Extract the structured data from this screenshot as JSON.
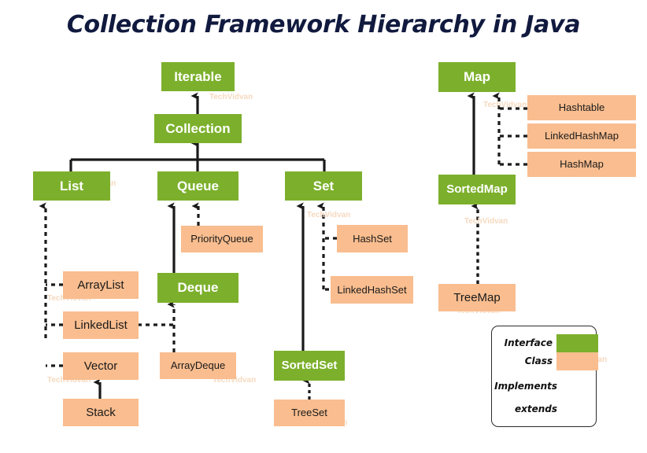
{
  "title": "Collection Framework Hierarchy in Java",
  "colors": {
    "interface": "#7cb02c",
    "class": "#f9bd8f",
    "title": "#111a3e",
    "line": "#1a1a1a",
    "background": "#ffffff",
    "watermark": "#f6d9bf"
  },
  "nodes": {
    "iterable": {
      "label": "Iterable",
      "kind": "interface"
    },
    "collection": {
      "label": "Collection",
      "kind": "interface"
    },
    "list": {
      "label": "List",
      "kind": "interface"
    },
    "queue": {
      "label": "Queue",
      "kind": "interface"
    },
    "set": {
      "label": "Set",
      "kind": "interface"
    },
    "deque": {
      "label": "Deque",
      "kind": "interface"
    },
    "sortedset": {
      "label": "SortedSet",
      "kind": "interface"
    },
    "map": {
      "label": "Map",
      "kind": "interface"
    },
    "sortedmap": {
      "label": "SortedMap",
      "kind": "interface"
    },
    "arraylist": {
      "label": "ArrayList",
      "kind": "class"
    },
    "linkedlist": {
      "label": "LinkedList",
      "kind": "class"
    },
    "vector": {
      "label": "Vector",
      "kind": "class"
    },
    "stack": {
      "label": "Stack",
      "kind": "class"
    },
    "priorityqueue": {
      "label": "PriorityQueue",
      "kind": "class"
    },
    "arraydeque": {
      "label": "ArrayDeque",
      "kind": "class"
    },
    "hashset": {
      "label": "HashSet",
      "kind": "class"
    },
    "linkedhashset": {
      "label": "LinkedHashSet",
      "kind": "class"
    },
    "treeset": {
      "label": "TreeSet",
      "kind": "class"
    },
    "hashtable": {
      "label": "Hashtable",
      "kind": "class"
    },
    "linkedhashmap": {
      "label": "LinkedHashMap",
      "kind": "class"
    },
    "hashmap": {
      "label": "HashMap",
      "kind": "class"
    },
    "treemap": {
      "label": "TreeMap",
      "kind": "class"
    }
  },
  "legend": {
    "interface_label": "Interface",
    "class_label": "Class",
    "implements_label": "Implements",
    "extends_label": "extends"
  },
  "watermark": {
    "text": "TechVidvan"
  },
  "relations": [
    {
      "from": "collection",
      "to": "iterable",
      "type": "extends"
    },
    {
      "from": "list",
      "to": "collection",
      "type": "extends"
    },
    {
      "from": "queue",
      "to": "collection",
      "type": "extends"
    },
    {
      "from": "set",
      "to": "collection",
      "type": "extends"
    },
    {
      "from": "arraylist",
      "to": "list",
      "type": "implements"
    },
    {
      "from": "linkedlist",
      "to": "list",
      "type": "implements"
    },
    {
      "from": "vector",
      "to": "list",
      "type": "implements"
    },
    {
      "from": "stack",
      "to": "vector",
      "type": "extends"
    },
    {
      "from": "priorityqueue",
      "to": "queue",
      "type": "implements"
    },
    {
      "from": "deque",
      "to": "queue",
      "type": "extends"
    },
    {
      "from": "arraydeque",
      "to": "deque",
      "type": "implements"
    },
    {
      "from": "linkedlist",
      "to": "deque",
      "type": "implements"
    },
    {
      "from": "hashset",
      "to": "set",
      "type": "implements"
    },
    {
      "from": "linkedhashset",
      "to": "set",
      "type": "implements"
    },
    {
      "from": "sortedset",
      "to": "set",
      "type": "extends"
    },
    {
      "from": "treeset",
      "to": "sortedset",
      "type": "implements"
    },
    {
      "from": "hashtable",
      "to": "map",
      "type": "implements"
    },
    {
      "from": "linkedhashmap",
      "to": "map",
      "type": "implements"
    },
    {
      "from": "hashmap",
      "to": "map",
      "type": "implements"
    },
    {
      "from": "sortedmap",
      "to": "map",
      "type": "extends"
    },
    {
      "from": "treemap",
      "to": "sortedmap",
      "type": "implements"
    }
  ]
}
